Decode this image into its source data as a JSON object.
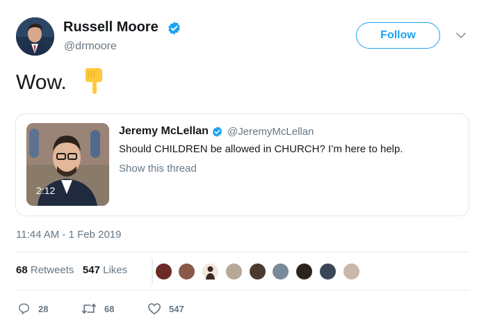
{
  "author": {
    "name": "Russell Moore",
    "handle": "@drmoore",
    "verified": true
  },
  "follow_button": {
    "label": "Follow"
  },
  "tweet": {
    "text": "Wow.",
    "emoji": "backhand-index-pointing-down"
  },
  "quoted_tweet": {
    "name": "Jeremy McLellan",
    "handle": "@JeremyMcLellan",
    "verified": true,
    "text": "Should CHILDREN be allowed in CHURCH? I’m here to help.",
    "thread_link": "Show this thread",
    "video_duration": "2:12"
  },
  "timestamp": "11:44 AM - 1 Feb 2019",
  "stats": {
    "retweets_count": "68",
    "retweets_label": "Retweets",
    "likes_count": "547",
    "likes_label": "Likes"
  },
  "actions": {
    "replies": "28",
    "retweets": "68",
    "likes": "547"
  },
  "colors": {
    "accent": "#1da1f2",
    "secondary_text": "#657786",
    "primary_text": "#14171a"
  }
}
